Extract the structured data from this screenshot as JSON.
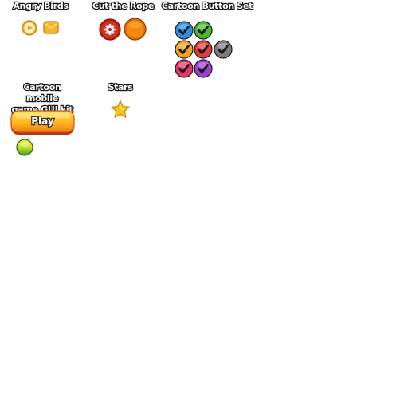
{
  "sections": {
    "angry_birds": {
      "title": "Angry Birds",
      "icons": [
        "play-icon",
        "envelope-icon"
      ]
    },
    "cut_the_rope": {
      "title": "Cut the Rope",
      "icons": [
        "gear-icon",
        "orange-round-button-icon"
      ]
    },
    "cartoon_button_set": {
      "title": "Cartoon Button Set",
      "icons": [
        "checkmark-icon"
      ],
      "button_colors": [
        "#2d8fe0",
        "#4cb82e",
        "#f0a51e",
        "#e23a3a",
        "#7c7c7c",
        "#e0366a",
        "#9a3fd0"
      ]
    },
    "cartoon_mobile_gui": {
      "title_line1": "Cartoon mobile",
      "title_line2": "game GUI kit",
      "play_label": "Play",
      "icons": [
        "green-yellow-ball-icon"
      ]
    },
    "stars": {
      "title": "Stars",
      "icons": [
        "star-icon"
      ]
    }
  }
}
